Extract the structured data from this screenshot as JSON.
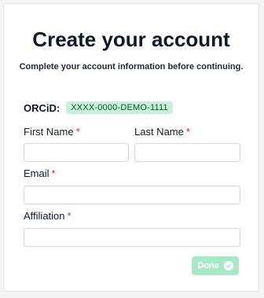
{
  "form": {
    "title": "Create your account",
    "subtitle": "Complete your account information before continuing.",
    "orcid_label": "ORCiD:",
    "orcid_value": "XXXX-0000-DEMO-1111",
    "required_marker": "*",
    "fields": {
      "first_name": {
        "label": "First Name",
        "value": ""
      },
      "last_name": {
        "label": "Last Name",
        "value": ""
      },
      "email": {
        "label": "Email",
        "value": ""
      },
      "affiliation": {
        "label": "Affiliation",
        "value": ""
      }
    },
    "done_label": "Done",
    "done_icon": "check-circle-icon"
  },
  "colors": {
    "required": "#dc2626",
    "badge_bg": "#c6f2d9",
    "button_disabled_bg": "#a7e9c6"
  }
}
